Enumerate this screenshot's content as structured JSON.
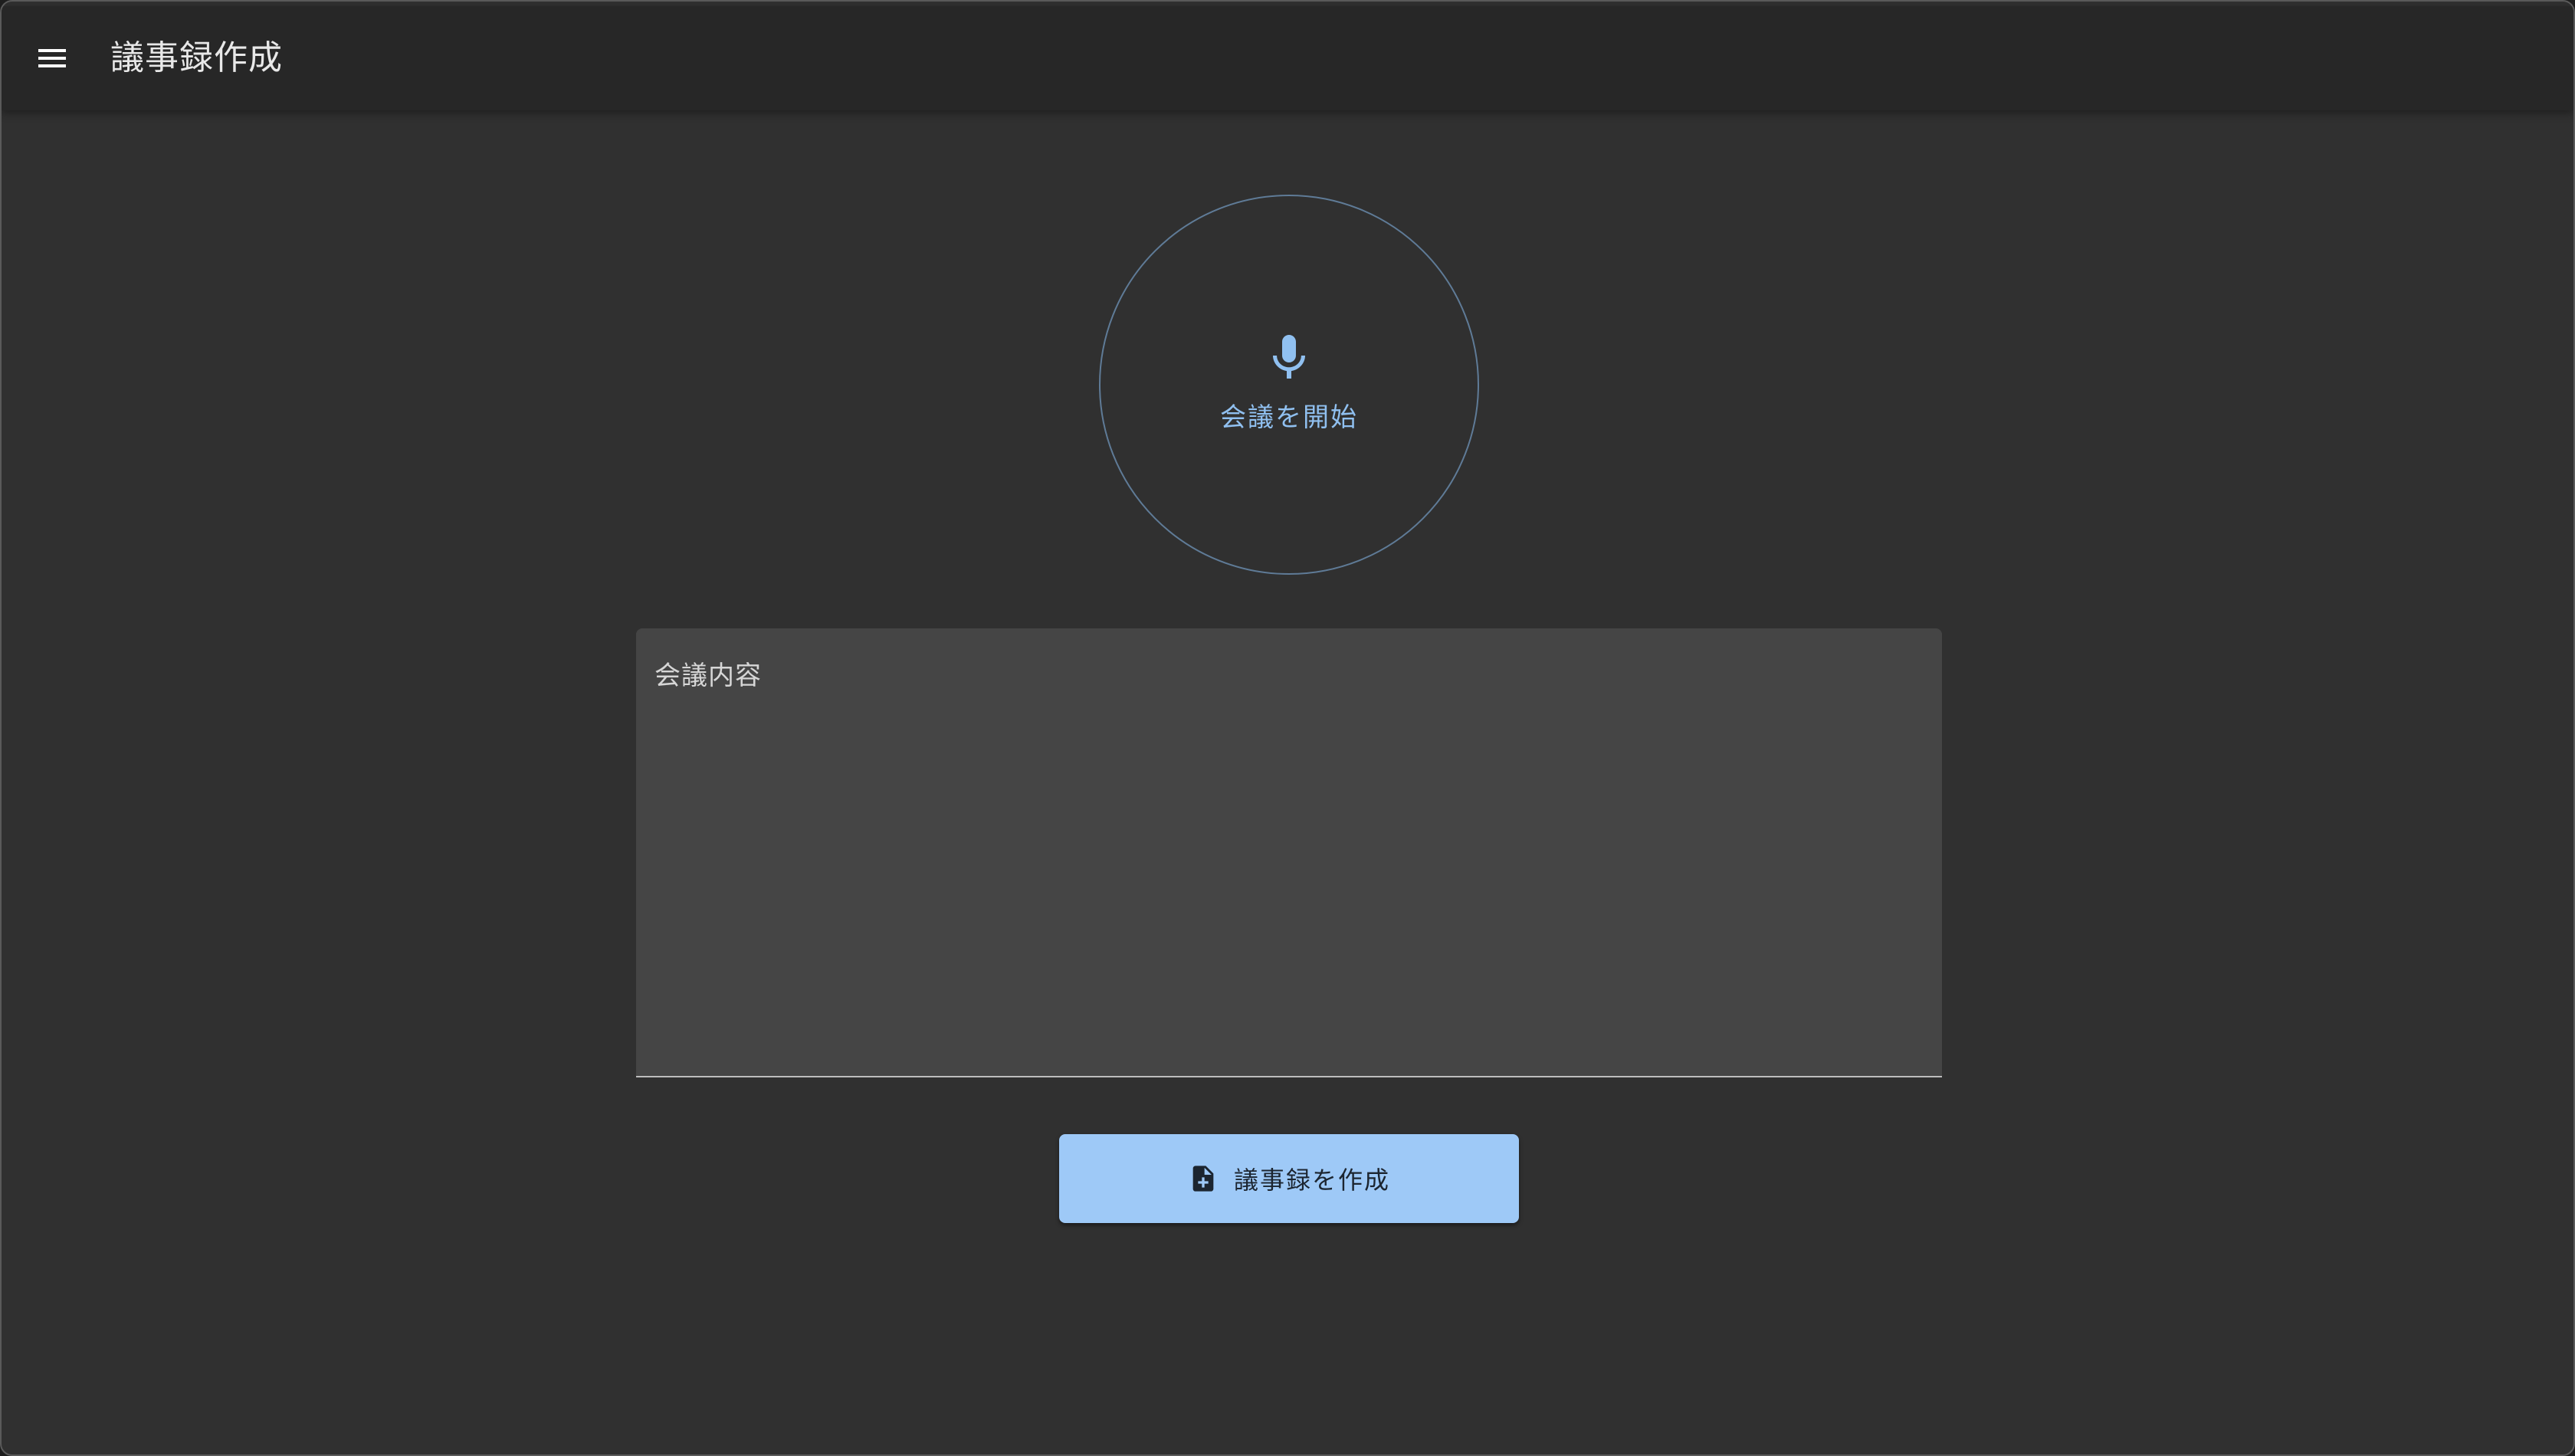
{
  "app": {
    "title": "議事録作成"
  },
  "icons": {
    "menu": "menu-icon",
    "mic": "microphone-icon",
    "create": "note-add-icon"
  },
  "meeting": {
    "start_label": "会議を開始"
  },
  "content_field": {
    "label": "会議内容",
    "value": ""
  },
  "actions": {
    "create_label": "議事録を作成"
  },
  "colors": {
    "accent": "#9ec9f7",
    "mic_accent": "#90c0f0",
    "background": "#303030",
    "appbar": "#272727",
    "field_bg": "#454545"
  }
}
